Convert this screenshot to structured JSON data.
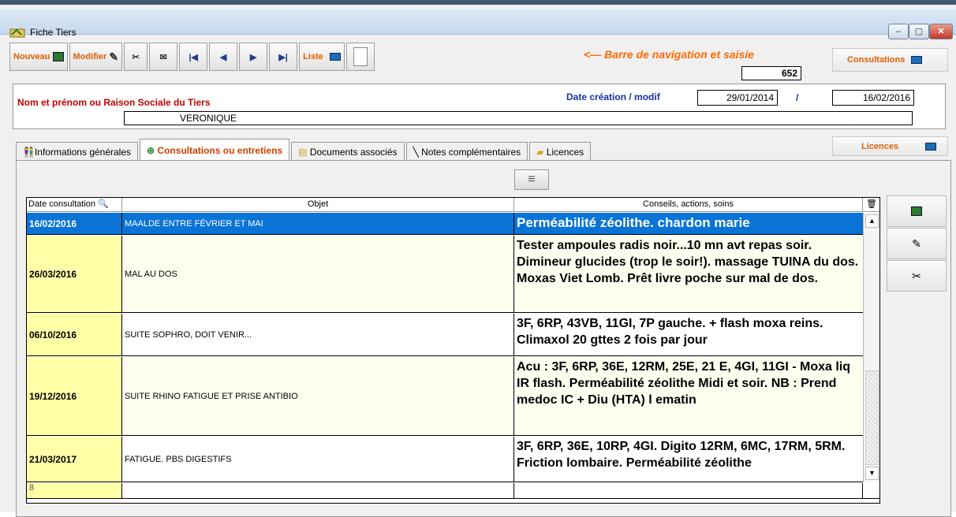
{
  "window": {
    "title": "Fiche Tiers",
    "min": "–",
    "max": "▢",
    "close": "✕"
  },
  "toolbar": {
    "nouveau": "Nouveau",
    "modifier": "Modifier",
    "liste": "Liste",
    "nav_label": "<— Barre de navigation et saisie",
    "record_number": "652",
    "consultations": "Consultations"
  },
  "tiers": {
    "nom_label": "Nom et prénom ou Raison Sociale du Tiers",
    "nom_value": "VERONIQUE",
    "date_label": "Date création / modif",
    "date_creation": "29/01/2014",
    "sep": "/",
    "date_modif": "16/02/2016"
  },
  "tabs": [
    {
      "label": "Informations générales"
    },
    {
      "label": "Consultations ou entretiens"
    },
    {
      "label": "Documents associés"
    },
    {
      "label": "Notes complémentaires"
    },
    {
      "label": "Licences"
    }
  ],
  "licences_button": "Licences",
  "grid": {
    "headers": [
      "Date consultation",
      "Objet",
      "Conseils, actions, soins"
    ],
    "rows": [
      {
        "date": "16/02/2016",
        "objet": "MAALDE ENTRE FÉVRIER ET MAI",
        "conseils": "Perméabilité zéolithe.  chardon marie"
      },
      {
        "date": "26/03/2016",
        "objet": "MAL AU DOS",
        "conseils": "Tester ampoules radis noir...10 mn avt repas soir. Dimineur glucides (trop le soir!). massage TUINA du dos. Moxas Viet Lomb. Prêt livre poche sur mal de dos."
      },
      {
        "date": "06/10/2016",
        "objet": "SUITE SOPHRO, DOIT VENIR...",
        "conseils": "3F, 6RP, 43VB, 11GI, 7P gauche. + flash moxa reins. Climaxol 20 gttes 2 fois par jour"
      },
      {
        "date": "19/12/2016",
        "objet": "SUITE RHINO FATIGUE ET PRISE ANTIBIO",
        "conseils": "Acu : 3F, 6RP, 36E, 12RM, 25E, 21 E, 4GI, 11GI - Moxa liq IR flash. Perméabilité zéolithe Midi et soir. NB : Prend medoc IC + Diu (HTA) l ematin"
      },
      {
        "date": "21/03/2017",
        "objet": "FATIGUE. PBS DIGESTIFS",
        "conseils": "3F, 6RP, 36E, 10RP, 4GI. Digito 12RM, 6MC, 17RM, 5RM. Friction lombaire. Perméabilité zéolithe"
      }
    ],
    "new_row_number": "8"
  }
}
